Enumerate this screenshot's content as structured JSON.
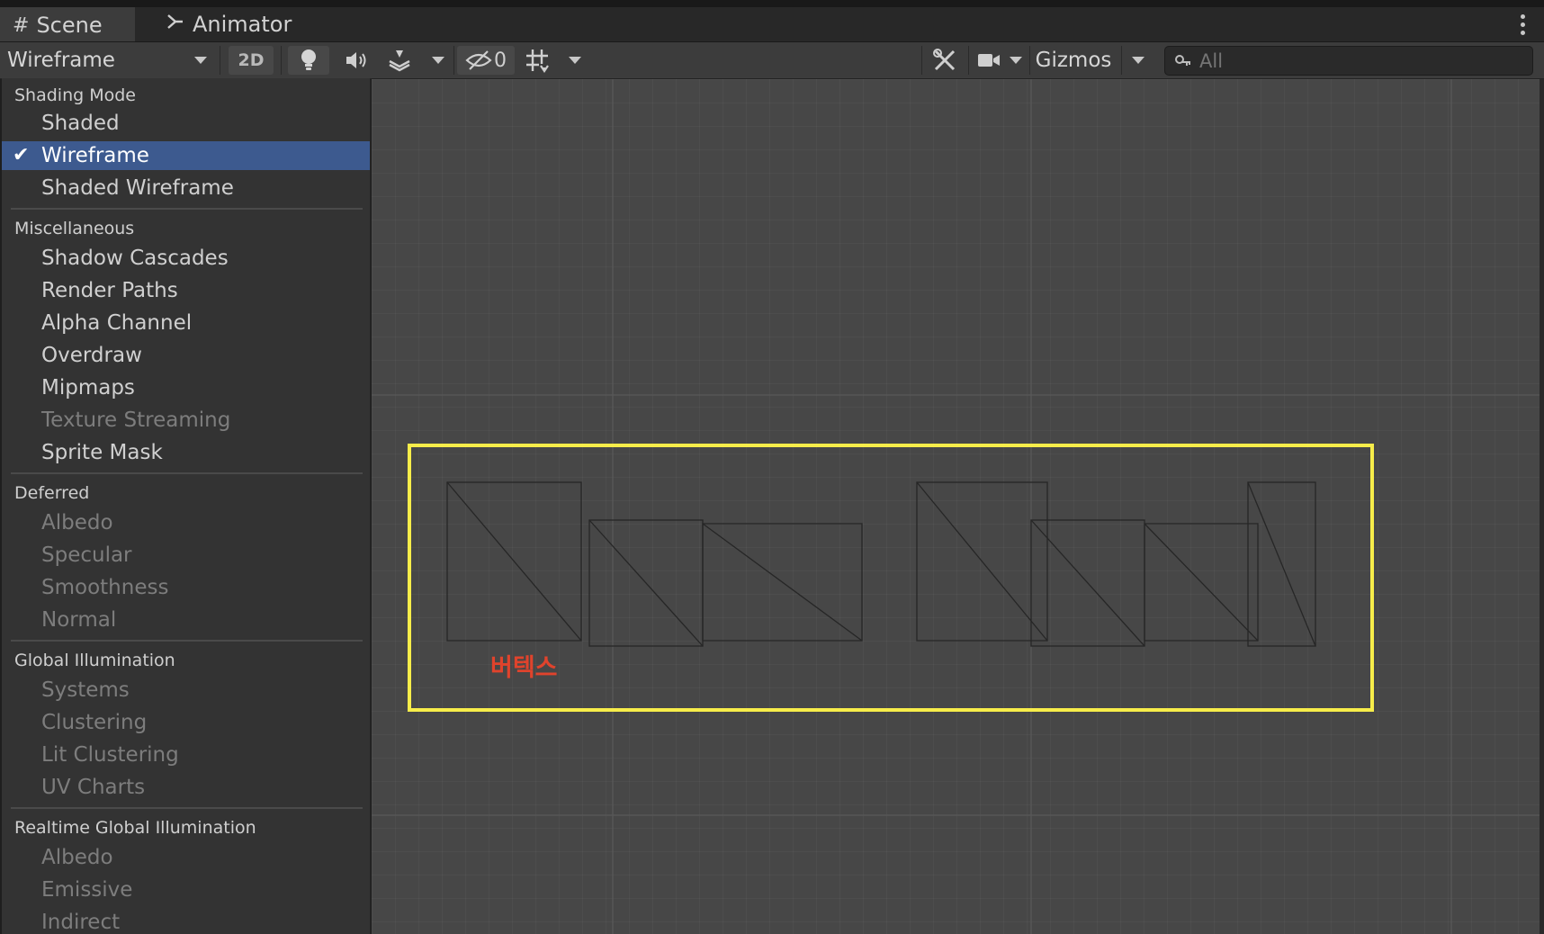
{
  "tabs": [
    {
      "label": "Scene",
      "icon": "grid-icon"
    },
    {
      "label": "Animator",
      "icon": "animator-icon"
    }
  ],
  "toolbar": {
    "draw_mode": "Wireframe",
    "mode_2d": "2D",
    "hidden_count": "0",
    "gizmos_label": "Gizmos",
    "search_placeholder": "All"
  },
  "menu": {
    "sections": [
      {
        "header": "Shading Mode",
        "items": [
          {
            "label": "Shaded",
            "enabled": true
          },
          {
            "label": "Wireframe",
            "enabled": true,
            "selected": true
          },
          {
            "label": "Shaded Wireframe",
            "enabled": true
          }
        ]
      },
      {
        "header": "Miscellaneous",
        "items": [
          {
            "label": "Shadow Cascades",
            "enabled": true
          },
          {
            "label": "Render Paths",
            "enabled": true
          },
          {
            "label": "Alpha Channel",
            "enabled": true
          },
          {
            "label": "Overdraw",
            "enabled": true
          },
          {
            "label": "Mipmaps",
            "enabled": true
          },
          {
            "label": "Texture Streaming",
            "enabled": false
          },
          {
            "label": "Sprite Mask",
            "enabled": true
          }
        ]
      },
      {
        "header": "Deferred",
        "items": [
          {
            "label": "Albedo",
            "enabled": false
          },
          {
            "label": "Specular",
            "enabled": false
          },
          {
            "label": "Smoothness",
            "enabled": false
          },
          {
            "label": "Normal",
            "enabled": false
          }
        ]
      },
      {
        "header": "Global Illumination",
        "items": [
          {
            "label": "Systems",
            "enabled": false
          },
          {
            "label": "Clustering",
            "enabled": false
          },
          {
            "label": "Lit Clustering",
            "enabled": false
          },
          {
            "label": "UV Charts",
            "enabled": false
          }
        ]
      },
      {
        "header": "Realtime Global Illumination",
        "items": [
          {
            "label": "Albedo",
            "enabled": false
          },
          {
            "label": "Emissive",
            "enabled": false
          },
          {
            "label": "Indirect",
            "enabled": false
          }
        ]
      }
    ]
  },
  "scene": {
    "annotation_label": "버텍스",
    "highlight_color": "#f7ed4a",
    "annotation_color": "#e0432c"
  },
  "colors": {
    "selection": "#3d5a8f",
    "panel": "#3c3c3c",
    "scene_bg": "#474747"
  }
}
